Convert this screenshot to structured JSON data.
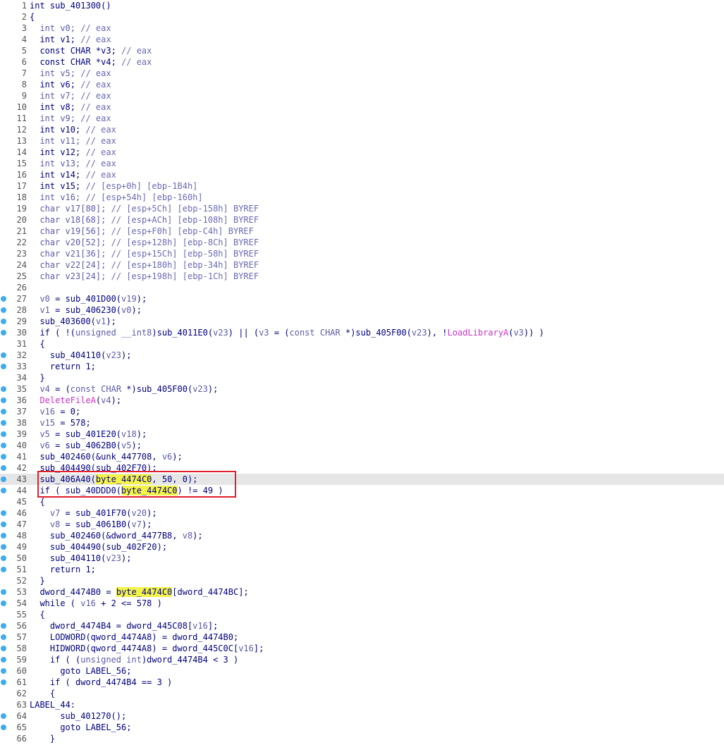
{
  "editor": {
    "view": "pseudocode",
    "current_line": 43,
    "highlight_color": "#f3f34a",
    "selection_box_color": "#e0202a",
    "lines": [
      {
        "n": "1",
        "bp": false,
        "indent": 0,
        "tokens": [
          [
            "kw",
            "int "
          ],
          [
            "pl",
            "sub_401300()"
          ]
        ]
      },
      {
        "n": "2",
        "bp": false,
        "indent": 0,
        "tokens": [
          [
            "pl",
            "{"
          ]
        ]
      },
      {
        "n": "3",
        "bp": false,
        "indent": 2,
        "tokens": [
          [
            "var",
            "int v0; "
          ],
          [
            "cmt",
            "// eax"
          ]
        ]
      },
      {
        "n": "4",
        "bp": false,
        "indent": 2,
        "tokens": [
          [
            "kw",
            "int v1; "
          ],
          [
            "cmt",
            "// eax"
          ]
        ]
      },
      {
        "n": "5",
        "bp": false,
        "indent": 2,
        "tokens": [
          [
            "kw",
            "const CHAR *v3; "
          ],
          [
            "cmt",
            "// eax"
          ]
        ]
      },
      {
        "n": "6",
        "bp": false,
        "indent": 2,
        "tokens": [
          [
            "kw",
            "const CHAR *v4; "
          ],
          [
            "cmt",
            "// eax"
          ]
        ]
      },
      {
        "n": "7",
        "bp": false,
        "indent": 2,
        "tokens": [
          [
            "var",
            "int v5; "
          ],
          [
            "cmt",
            "// eax"
          ]
        ]
      },
      {
        "n": "8",
        "bp": false,
        "indent": 2,
        "tokens": [
          [
            "kw",
            "int v6; "
          ],
          [
            "cmt",
            "// eax"
          ]
        ]
      },
      {
        "n": "9",
        "bp": false,
        "indent": 2,
        "tokens": [
          [
            "var",
            "int v7; "
          ],
          [
            "cmt",
            "// eax"
          ]
        ]
      },
      {
        "n": "10",
        "bp": false,
        "indent": 2,
        "tokens": [
          [
            "kw",
            "int v8; "
          ],
          [
            "cmt",
            "// eax"
          ]
        ]
      },
      {
        "n": "11",
        "bp": false,
        "indent": 2,
        "tokens": [
          [
            "var",
            "int v9; "
          ],
          [
            "cmt",
            "// eax"
          ]
        ]
      },
      {
        "n": "12",
        "bp": false,
        "indent": 2,
        "tokens": [
          [
            "kw",
            "int v10; "
          ],
          [
            "cmt",
            "// eax"
          ]
        ]
      },
      {
        "n": "13",
        "bp": false,
        "indent": 2,
        "tokens": [
          [
            "var",
            "int v11; "
          ],
          [
            "cmt",
            "// eax"
          ]
        ]
      },
      {
        "n": "14",
        "bp": false,
        "indent": 2,
        "tokens": [
          [
            "kw",
            "int v12; "
          ],
          [
            "cmt",
            "// eax"
          ]
        ]
      },
      {
        "n": "15",
        "bp": false,
        "indent": 2,
        "tokens": [
          [
            "var",
            "int v13; "
          ],
          [
            "cmt",
            "// eax"
          ]
        ]
      },
      {
        "n": "16",
        "bp": false,
        "indent": 2,
        "tokens": [
          [
            "kw",
            "int v14; "
          ],
          [
            "cmt",
            "// eax"
          ]
        ]
      },
      {
        "n": "17",
        "bp": false,
        "indent": 2,
        "tokens": [
          [
            "kw",
            "int v15; "
          ],
          [
            "cmt",
            "// [esp+0h] [ebp-1B4h]"
          ]
        ]
      },
      {
        "n": "18",
        "bp": false,
        "indent": 2,
        "tokens": [
          [
            "var",
            "int v16; "
          ],
          [
            "cmt",
            "// [esp+54h] [ebp-160h]"
          ]
        ]
      },
      {
        "n": "19",
        "bp": false,
        "indent": 2,
        "tokens": [
          [
            "var",
            "char v17[80]; "
          ],
          [
            "cmt",
            "// [esp+5Ch] [ebp-158h] BYREF"
          ]
        ]
      },
      {
        "n": "20",
        "bp": false,
        "indent": 2,
        "tokens": [
          [
            "var",
            "char v18[68]; "
          ],
          [
            "cmt",
            "// [esp+ACh] [ebp-108h] BYREF"
          ]
        ]
      },
      {
        "n": "21",
        "bp": false,
        "indent": 2,
        "tokens": [
          [
            "var",
            "char v19[56]; "
          ],
          [
            "cmt",
            "// [esp+F0h] [ebp-C4h] BYREF"
          ]
        ]
      },
      {
        "n": "22",
        "bp": false,
        "indent": 2,
        "tokens": [
          [
            "var",
            "char v20[52]; "
          ],
          [
            "cmt",
            "// [esp+128h] [ebp-8Ch] BYREF"
          ]
        ]
      },
      {
        "n": "23",
        "bp": false,
        "indent": 2,
        "tokens": [
          [
            "var",
            "char v21[36]; "
          ],
          [
            "cmt",
            "// [esp+15Ch] [ebp-58h] BYREF"
          ]
        ]
      },
      {
        "n": "24",
        "bp": false,
        "indent": 2,
        "tokens": [
          [
            "var",
            "char v22[24]; "
          ],
          [
            "cmt",
            "// [esp+180h] [ebp-34h] BYREF"
          ]
        ]
      },
      {
        "n": "25",
        "bp": false,
        "indent": 2,
        "tokens": [
          [
            "var",
            "char v23[24]; "
          ],
          [
            "cmt",
            "// [esp+198h] [ebp-1Ch] BYREF"
          ]
        ]
      },
      {
        "n": "26",
        "bp": false,
        "indent": 0,
        "tokens": []
      },
      {
        "n": "27",
        "bp": true,
        "indent": 2,
        "tokens": [
          [
            "var",
            "v0"
          ],
          [
            "pl",
            " = sub_401D00("
          ],
          [
            "var",
            "v19"
          ],
          [
            "pl",
            ");"
          ]
        ]
      },
      {
        "n": "28",
        "bp": true,
        "indent": 2,
        "tokens": [
          [
            "var",
            "v1"
          ],
          [
            "pl",
            " = sub_406230("
          ],
          [
            "var",
            "v0"
          ],
          [
            "pl",
            ");"
          ]
        ]
      },
      {
        "n": "29",
        "bp": true,
        "indent": 2,
        "tokens": [
          [
            "pl",
            "sub_403600("
          ],
          [
            "var",
            "v1"
          ],
          [
            "pl",
            ");"
          ]
        ]
      },
      {
        "n": "30",
        "bp": true,
        "indent": 2,
        "tokens": [
          [
            "pl",
            "if ( !("
          ],
          [
            "var",
            "unsigned __int8"
          ],
          [
            "pl",
            ")sub_4011E0("
          ],
          [
            "var",
            "v23"
          ],
          [
            "pl",
            ") || ("
          ],
          [
            "var",
            "v3"
          ],
          [
            "pl",
            " = ("
          ],
          [
            "var",
            "const CHAR "
          ],
          [
            "pl",
            "*)sub_405F00("
          ],
          [
            "var",
            "v23"
          ],
          [
            "pl",
            "), !"
          ],
          [
            "imp",
            "LoadLibraryA"
          ],
          [
            "pl",
            "("
          ],
          [
            "var",
            "v3"
          ],
          [
            "pl",
            ")) )"
          ]
        ]
      },
      {
        "n": "31",
        "bp": false,
        "indent": 2,
        "tokens": [
          [
            "pl",
            "{"
          ]
        ]
      },
      {
        "n": "32",
        "bp": true,
        "indent": 4,
        "tokens": [
          [
            "pl",
            "sub_404110("
          ],
          [
            "var",
            "v23"
          ],
          [
            "pl",
            ");"
          ]
        ]
      },
      {
        "n": "33",
        "bp": true,
        "indent": 4,
        "tokens": [
          [
            "pl",
            "return 1;"
          ]
        ]
      },
      {
        "n": "34",
        "bp": false,
        "indent": 2,
        "tokens": [
          [
            "pl",
            "}"
          ]
        ]
      },
      {
        "n": "35",
        "bp": true,
        "indent": 2,
        "tokens": [
          [
            "var",
            "v4"
          ],
          [
            "pl",
            " = ("
          ],
          [
            "var",
            "const CHAR "
          ],
          [
            "pl",
            "*)sub_405F00("
          ],
          [
            "var",
            "v23"
          ],
          [
            "pl",
            ");"
          ]
        ]
      },
      {
        "n": "36",
        "bp": true,
        "indent": 2,
        "tokens": [
          [
            "imp",
            "DeleteFileA"
          ],
          [
            "pl",
            "("
          ],
          [
            "var",
            "v4"
          ],
          [
            "pl",
            ");"
          ]
        ]
      },
      {
        "n": "37",
        "bp": true,
        "indent": 2,
        "tokens": [
          [
            "var",
            "v16"
          ],
          [
            "pl",
            " = 0;"
          ]
        ]
      },
      {
        "n": "38",
        "bp": true,
        "indent": 2,
        "tokens": [
          [
            "var",
            "v15"
          ],
          [
            "pl",
            " = 578;"
          ]
        ]
      },
      {
        "n": "39",
        "bp": true,
        "indent": 2,
        "tokens": [
          [
            "var",
            "v5"
          ],
          [
            "pl",
            " = sub_401E20("
          ],
          [
            "var",
            "v18"
          ],
          [
            "pl",
            ");"
          ]
        ]
      },
      {
        "n": "40",
        "bp": true,
        "indent": 2,
        "tokens": [
          [
            "var",
            "v6"
          ],
          [
            "pl",
            " = sub_4062B0("
          ],
          [
            "var",
            "v5"
          ],
          [
            "pl",
            ");"
          ]
        ]
      },
      {
        "n": "41",
        "bp": true,
        "indent": 2,
        "tokens": [
          [
            "pl",
            "sub_402460(&unk_447708, "
          ],
          [
            "var",
            "v6"
          ],
          [
            "pl",
            ");"
          ]
        ]
      },
      {
        "n": "42",
        "bp": true,
        "indent": 2,
        "tokens": [
          [
            "pl",
            "sub_404490(sub_402F70);"
          ]
        ]
      },
      {
        "n": "43",
        "bp": true,
        "indent": 2,
        "tokens": [
          [
            "pl",
            "sub_406A40("
          ],
          [
            "caret",
            ""
          ],
          [
            "hl",
            "byte_4474C0"
          ],
          [
            "pl",
            ", 50, 0);"
          ]
        ]
      },
      {
        "n": "44",
        "bp": true,
        "indent": 2,
        "tokens": [
          [
            "pl",
            "if ( sub_40DDD0("
          ],
          [
            "hl",
            "byte_4474C0"
          ],
          [
            "pl",
            ") != 49 )"
          ]
        ]
      },
      {
        "n": "45",
        "bp": false,
        "indent": 2,
        "tokens": [
          [
            "pl",
            "{"
          ]
        ]
      },
      {
        "n": "46",
        "bp": true,
        "indent": 4,
        "tokens": [
          [
            "var",
            "v7"
          ],
          [
            "pl",
            " = sub_401F70("
          ],
          [
            "var",
            "v20"
          ],
          [
            "pl",
            ");"
          ]
        ]
      },
      {
        "n": "47",
        "bp": true,
        "indent": 4,
        "tokens": [
          [
            "var",
            "v8"
          ],
          [
            "pl",
            " = sub_4061B0("
          ],
          [
            "var",
            "v7"
          ],
          [
            "pl",
            ");"
          ]
        ]
      },
      {
        "n": "48",
        "bp": true,
        "indent": 4,
        "tokens": [
          [
            "pl",
            "sub_402460(&dword_4477B8, "
          ],
          [
            "var",
            "v8"
          ],
          [
            "pl",
            ");"
          ]
        ]
      },
      {
        "n": "49",
        "bp": true,
        "indent": 4,
        "tokens": [
          [
            "pl",
            "sub_404490(sub_402F20);"
          ]
        ]
      },
      {
        "n": "50",
        "bp": true,
        "indent": 4,
        "tokens": [
          [
            "pl",
            "sub_404110("
          ],
          [
            "var",
            "v23"
          ],
          [
            "pl",
            ");"
          ]
        ]
      },
      {
        "n": "51",
        "bp": true,
        "indent": 4,
        "tokens": [
          [
            "pl",
            "return 1;"
          ]
        ]
      },
      {
        "n": "52",
        "bp": false,
        "indent": 2,
        "tokens": [
          [
            "pl",
            "}"
          ]
        ]
      },
      {
        "n": "53",
        "bp": true,
        "indent": 2,
        "tokens": [
          [
            "pl",
            "dword_4474B0 = "
          ],
          [
            "hl",
            "byte_4474C0"
          ],
          [
            "pl",
            "[dword_4474BC];"
          ]
        ]
      },
      {
        "n": "54",
        "bp": true,
        "indent": 2,
        "tokens": [
          [
            "pl",
            "while ( "
          ],
          [
            "var",
            "v16"
          ],
          [
            "pl",
            " + 2 <= 578 )"
          ]
        ]
      },
      {
        "n": "55",
        "bp": false,
        "indent": 2,
        "tokens": [
          [
            "pl",
            "{"
          ]
        ]
      },
      {
        "n": "56",
        "bp": true,
        "indent": 4,
        "tokens": [
          [
            "pl",
            "dword_4474B4 = dword_445C08["
          ],
          [
            "var",
            "v16"
          ],
          [
            "pl",
            "];"
          ]
        ]
      },
      {
        "n": "57",
        "bp": true,
        "indent": 4,
        "tokens": [
          [
            "pl",
            "LODWORD(qword_4474A8) = dword_4474B0;"
          ]
        ]
      },
      {
        "n": "58",
        "bp": true,
        "indent": 4,
        "tokens": [
          [
            "pl",
            "HIDWORD(qword_4474A8) = dword_445C0C["
          ],
          [
            "var",
            "v16"
          ],
          [
            "pl",
            "];"
          ]
        ]
      },
      {
        "n": "59",
        "bp": true,
        "indent": 4,
        "tokens": [
          [
            "pl",
            "if ( ("
          ],
          [
            "var",
            "unsigned int"
          ],
          [
            "pl",
            ")dword_4474B4 < 3 )"
          ]
        ]
      },
      {
        "n": "60",
        "bp": true,
        "indent": 6,
        "tokens": [
          [
            "pl",
            "goto LABEL_56;"
          ]
        ]
      },
      {
        "n": "61",
        "bp": true,
        "indent": 4,
        "tokens": [
          [
            "pl",
            "if ( dword_4474B4 == 3 )"
          ]
        ]
      },
      {
        "n": "62",
        "bp": false,
        "indent": 4,
        "tokens": [
          [
            "pl",
            "{"
          ]
        ]
      },
      {
        "n": "63",
        "bp": false,
        "indent": 0,
        "tokens": [
          [
            "pl",
            "LABEL_44:"
          ]
        ]
      },
      {
        "n": "64",
        "bp": true,
        "indent": 6,
        "tokens": [
          [
            "pl",
            "sub_401270();"
          ]
        ]
      },
      {
        "n": "65",
        "bp": true,
        "indent": 6,
        "tokens": [
          [
            "pl",
            "goto LABEL_56;"
          ]
        ]
      },
      {
        "n": "66",
        "bp": false,
        "indent": 4,
        "tokens": [
          [
            "pl",
            "}"
          ]
        ]
      }
    ]
  }
}
